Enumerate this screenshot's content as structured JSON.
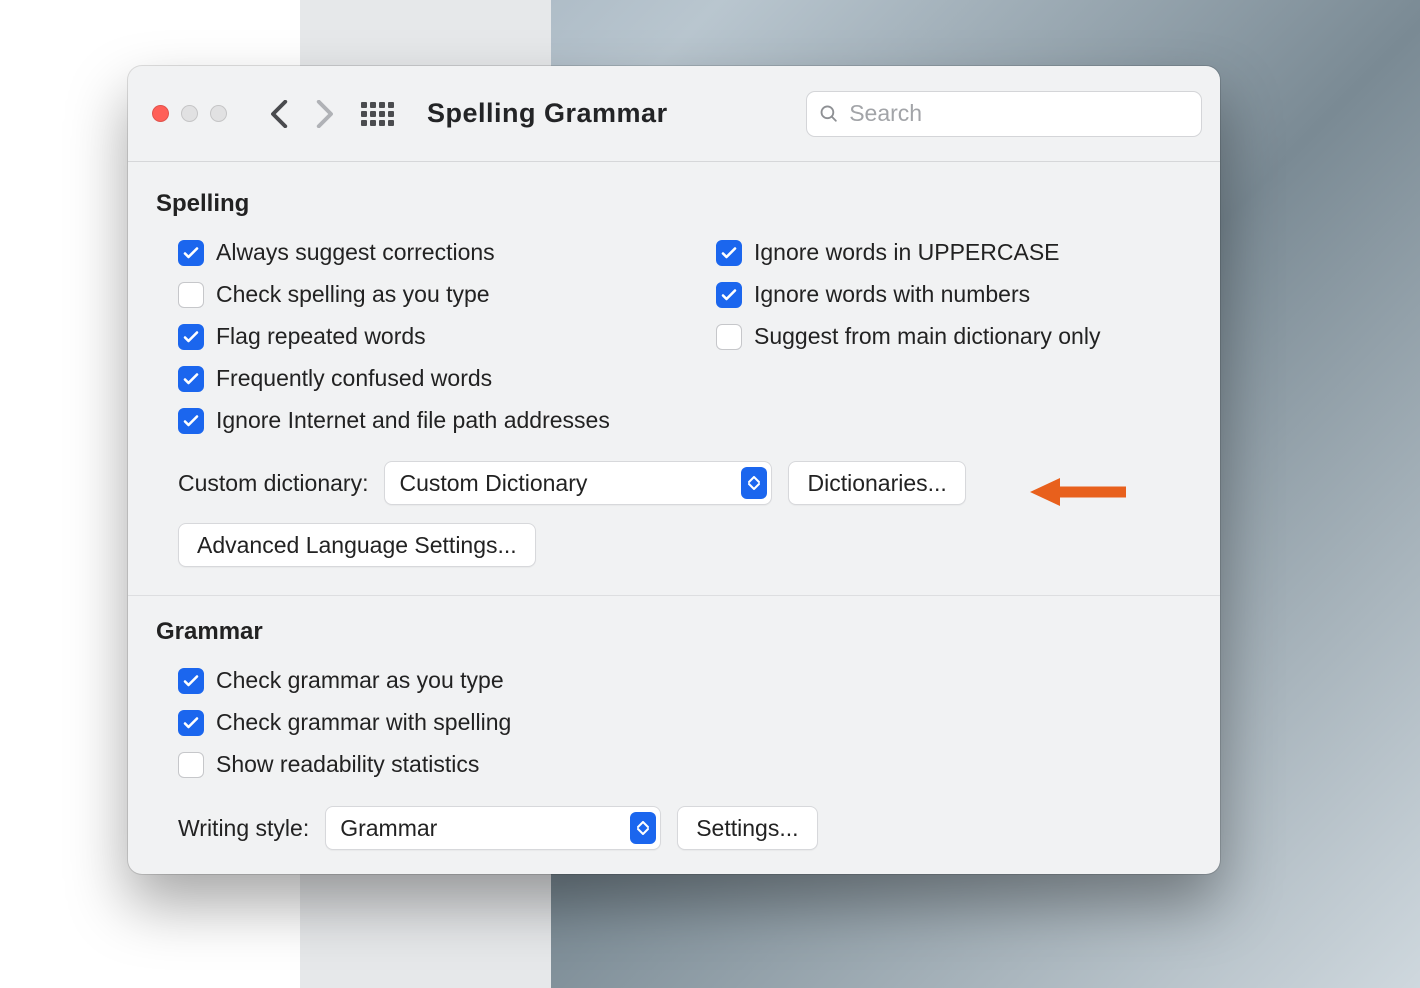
{
  "window": {
    "title": "Spelling  Grammar",
    "search_placeholder": "Search"
  },
  "spelling": {
    "heading": "Spelling",
    "left": [
      {
        "label": "Always suggest corrections",
        "checked": true
      },
      {
        "label": "Check spelling as you type",
        "checked": false
      },
      {
        "label": "Flag repeated words",
        "checked": true
      },
      {
        "label": "Frequently confused words",
        "checked": true
      },
      {
        "label": "Ignore Internet and file path addresses",
        "checked": true
      }
    ],
    "right": [
      {
        "label": "Ignore words in UPPERCASE",
        "checked": true
      },
      {
        "label": "Ignore words with numbers",
        "checked": true
      },
      {
        "label": "Suggest from main dictionary only",
        "checked": false
      }
    ],
    "custom_dict_label": "Custom dictionary:",
    "custom_dict_value": "Custom Dictionary",
    "dictionaries_button": "Dictionaries...",
    "advanced_button": "Advanced Language Settings..."
  },
  "grammar": {
    "heading": "Grammar",
    "items": [
      {
        "label": "Check grammar as you type",
        "checked": true
      },
      {
        "label": "Check grammar with spelling",
        "checked": true
      },
      {
        "label": "Show readability statistics",
        "checked": false
      }
    ],
    "writing_style_label": "Writing style:",
    "writing_style_value": "Grammar",
    "settings_button": "Settings..."
  }
}
